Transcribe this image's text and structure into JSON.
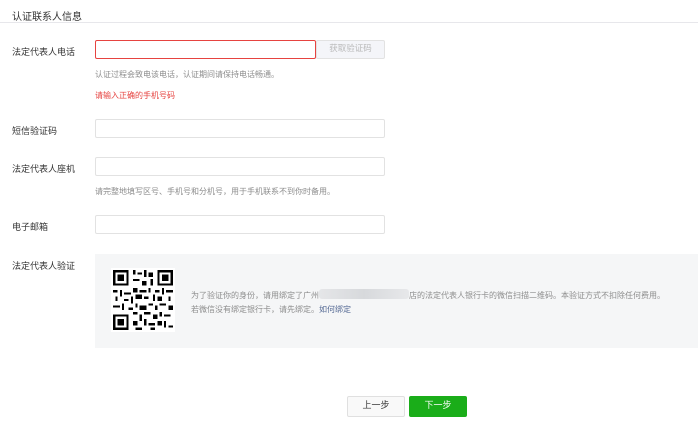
{
  "section": {
    "title": "认证联系人信息"
  },
  "fields": {
    "phone": {
      "label": "法定代表人电话",
      "value": "",
      "get_code_label": "获取验证码",
      "hint": "认证过程会致电该电话，认证期间请保持电话畅通。",
      "error": "请输入正确的手机号码"
    },
    "sms": {
      "label": "短信验证码",
      "value": ""
    },
    "landline": {
      "label": "法定代表人座机",
      "value": "",
      "hint": "请完整地填写区号、手机号和分机号，用于手机联系不到你时备用。"
    },
    "email": {
      "label": "电子邮箱",
      "value": ""
    },
    "verify": {
      "label": "法定代表人验证",
      "text_before": "为了验证你的身份，请用绑定了广州",
      "text_after": "店的法定代表人银行卡的微信扫描二维码。本验证方式不扣除任何费用。",
      "text_line2": "若微信没有绑定银行卡，请先绑定。",
      "link": "如何绑定"
    }
  },
  "buttons": {
    "prev": "上一步",
    "next": "下一步"
  },
  "colors": {
    "error": "#e64340",
    "primary": "#1aad19",
    "link": "#576b95"
  }
}
